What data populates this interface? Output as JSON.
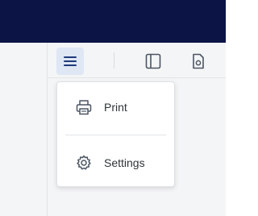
{
  "colors": {
    "topbar": "#0b1445",
    "toolbar_bg": "#f4f5f6",
    "active_bg": "#dfe7f4",
    "icon": "#4b5563",
    "accent": "#1f3a7a"
  },
  "toolbar": {
    "buttons": [
      {
        "icon": "hamburger-menu-icon",
        "active": true
      },
      {
        "icon": "sidebar-panel-icon",
        "active": false
      },
      {
        "icon": "document-view-icon",
        "active": false
      }
    ]
  },
  "menu": {
    "items": [
      {
        "icon": "printer-icon",
        "label": "Print"
      },
      {
        "icon": "gear-icon",
        "label": "Settings"
      }
    ]
  }
}
